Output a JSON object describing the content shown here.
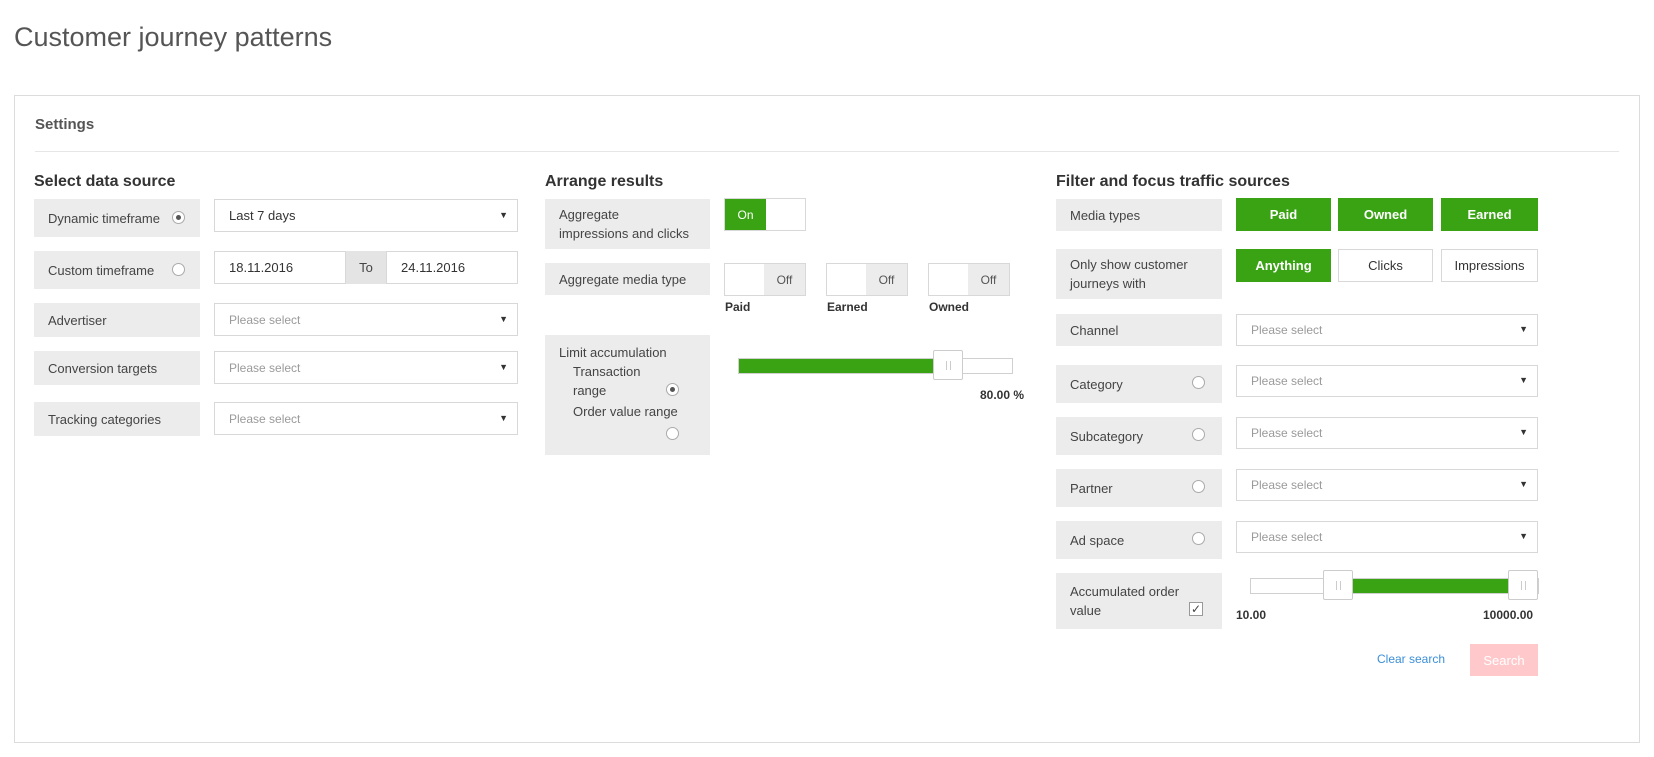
{
  "page": {
    "title": "Customer journey patterns"
  },
  "settings": {
    "label": "Settings"
  },
  "data_source": {
    "heading": "Select data source",
    "dynamic_timeframe": {
      "label": "Dynamic timeframe",
      "selected": true,
      "value": "Last 7 days"
    },
    "custom_timeframe": {
      "label": "Custom timeframe",
      "selected": false,
      "from": "18.11.2016",
      "to_label": "To",
      "to": "24.11.2016"
    },
    "advertiser": {
      "label": "Advertiser",
      "placeholder": "Please select"
    },
    "conversion_targets": {
      "label": "Conversion targets",
      "placeholder": "Please select"
    },
    "tracking_categories": {
      "label": "Tracking categories",
      "placeholder": "Please select"
    }
  },
  "arrange": {
    "heading": "Arrange results",
    "aggregate_impr": {
      "line1": "Aggregate",
      "line2": "impressions and clicks",
      "state": "On"
    },
    "aggregate_media": {
      "label": "Aggregate media type",
      "toggles": [
        {
          "name": "Paid",
          "state": "Off"
        },
        {
          "name": "Earned",
          "state": "Off"
        },
        {
          "name": "Owned",
          "state": "Off"
        }
      ]
    },
    "limit": {
      "label": "Limit accumulation",
      "option1_line1": "Transaction",
      "option1_line2": "range",
      "option2": "Order value range",
      "selected": "Transaction range",
      "value_percent": 80,
      "value_text": "80.00 %"
    }
  },
  "filter": {
    "heading": "Filter and focus traffic sources",
    "media_types": {
      "label": "Media types",
      "buttons": [
        "Paid",
        "Owned",
        "Earned"
      ],
      "active": [
        "Paid",
        "Owned",
        "Earned"
      ]
    },
    "only_show": {
      "line1": "Only show customer",
      "line2": "journeys with",
      "buttons": [
        "Anything",
        "Clicks",
        "Impressions"
      ],
      "active": "Anything"
    },
    "channel": {
      "label": "Channel",
      "placeholder": "Please select"
    },
    "category": {
      "label": "Category",
      "placeholder": "Please select"
    },
    "subcategory": {
      "label": "Subcategory",
      "placeholder": "Please select"
    },
    "partner": {
      "label": "Partner",
      "placeholder": "Please select"
    },
    "ad_space": {
      "label": "Ad space",
      "placeholder": "Please select"
    },
    "accumulated_order": {
      "line1": "Accumulated order",
      "line2": "value",
      "checked": true,
      "min": "10.00",
      "max": "10000.00",
      "low_fraction": 0.28,
      "high_fraction": 1.0
    },
    "clear_label": "Clear search",
    "search_label": "Search"
  },
  "colors": {
    "accent": "#3aa314",
    "search_disabled": "#ffc9cc",
    "link": "#3b8fd8"
  }
}
